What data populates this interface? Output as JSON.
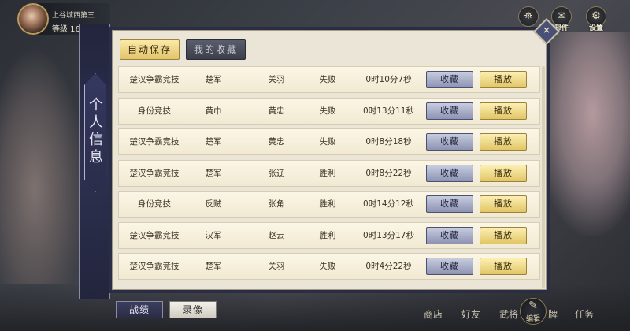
{
  "player": {
    "name": "上谷城西第三",
    "level": "等级 16"
  },
  "top_icons": [
    {
      "name": "lantern-icon",
      "glyph": "⛯",
      "label": ""
    },
    {
      "name": "mail-icon",
      "glyph": "✉",
      "label": "邮件"
    },
    {
      "name": "settings-icon",
      "glyph": "⚙",
      "label": "设置"
    }
  ],
  "side_tab": {
    "label": "个人信息"
  },
  "tabs": {
    "auto_save": "自动保存",
    "my_favorites": "我的收藏"
  },
  "row_buttons": {
    "favorite": "收藏",
    "play": "播放"
  },
  "records": [
    {
      "mode": "楚汉争霸竞技",
      "side": "楚军",
      "hero": "关羽",
      "result": "失败",
      "time": "0时10分7秒"
    },
    {
      "mode": "身份竞技",
      "side": "黄巾",
      "hero": "黄忠",
      "result": "失败",
      "time": "0时13分11秒"
    },
    {
      "mode": "楚汉争霸竞技",
      "side": "楚军",
      "hero": "黄忠",
      "result": "失败",
      "time": "0时8分18秒"
    },
    {
      "mode": "楚汉争霸竞技",
      "side": "楚军",
      "hero": "张辽",
      "result": "胜利",
      "time": "0时8分22秒"
    },
    {
      "mode": "身份竞技",
      "side": "反贼",
      "hero": "张角",
      "result": "胜利",
      "time": "0时14分12秒"
    },
    {
      "mode": "楚汉争霸竞技",
      "side": "汉军",
      "hero": "赵云",
      "result": "胜利",
      "time": "0时13分17秒"
    },
    {
      "mode": "楚汉争霸竞技",
      "side": "楚军",
      "hero": "关羽",
      "result": "失败",
      "time": "0时4分22秒"
    }
  ],
  "bottom_tabs": {
    "record": "战绩",
    "video": "录像"
  },
  "bottom_nav": {
    "shop": "商店",
    "friends": "好友",
    "generals": "武将",
    "cards": "牌",
    "tasks": "任务",
    "edit": "编辑",
    "edit_glyph": "✎"
  }
}
